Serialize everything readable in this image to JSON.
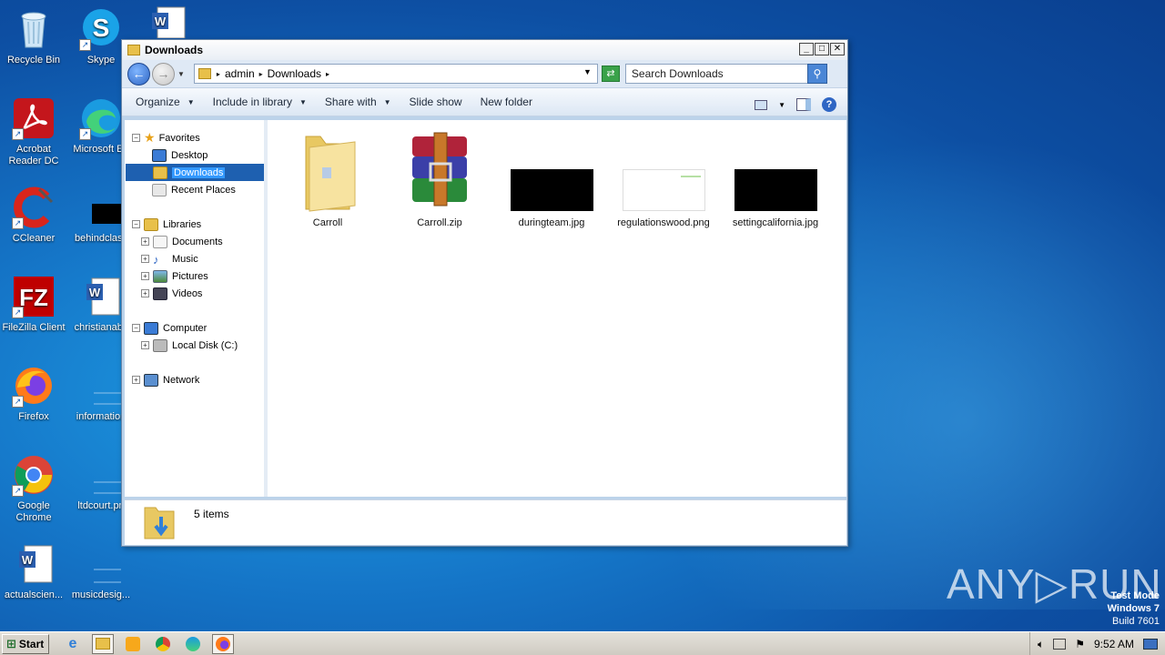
{
  "desktop": {
    "icons": [
      {
        "label": "Recycle Bin"
      },
      {
        "label": "Skype"
      },
      {
        "label": "Acrobat Reader DC"
      },
      {
        "label": "Microsoft Ed"
      },
      {
        "label": "CCleaner"
      },
      {
        "label": "behindclass"
      },
      {
        "label": "FileZilla Client"
      },
      {
        "label": "christianabs"
      },
      {
        "label": "Firefox"
      },
      {
        "label": "information"
      },
      {
        "label": "Google Chrome"
      },
      {
        "label": "ltdcourt.pn"
      },
      {
        "label": "actualscien..."
      },
      {
        "label": "musicdesig..."
      }
    ],
    "watermark": "ANY▷RUN",
    "test_mode": {
      "line1": "Test Mode",
      "line2": "Windows 7",
      "line3": "Build 7601"
    }
  },
  "window": {
    "title": "Downloads",
    "controls": {
      "minimize": "_",
      "maximize": "□",
      "close": "✕"
    },
    "address": {
      "crumbs": [
        "admin",
        "Downloads"
      ]
    },
    "search": {
      "placeholder": "Search Downloads"
    },
    "toolbar": {
      "organize": "Organize",
      "include_in_library": "Include in library",
      "share_with": "Share with",
      "slide_show": "Slide show",
      "new_folder": "New folder",
      "help": "?"
    },
    "nav": {
      "favorites": "Favorites",
      "desktop": "Desktop",
      "downloads": "Downloads",
      "recent_places": "Recent Places",
      "libraries": "Libraries",
      "documents": "Documents",
      "music": "Music",
      "pictures": "Pictures",
      "videos": "Videos",
      "computer": "Computer",
      "local_disk": "Local Disk (C:)",
      "network": "Network"
    },
    "files": [
      {
        "name": "Carroll",
        "type": "folder"
      },
      {
        "name": "Carroll.zip",
        "type": "archive"
      },
      {
        "name": "duringteam.jpg",
        "type": "image-dark"
      },
      {
        "name": "regulationswood.png",
        "type": "image-light"
      },
      {
        "name": "settingcalifornia.jpg",
        "type": "image-dark"
      }
    ],
    "status": {
      "count": "5 items"
    }
  },
  "taskbar": {
    "start": "Start",
    "clock": "9:52 AM"
  },
  "colors": {
    "selection": "#3399ff",
    "desktop": "#1576c8"
  }
}
